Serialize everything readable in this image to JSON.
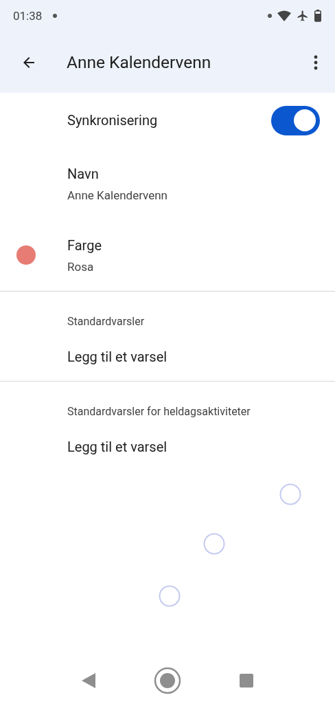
{
  "status_bar": {
    "time": "01:38"
  },
  "app_bar": {
    "title": "Anne Kalendervenn"
  },
  "settings": [
    {
      "kind": "toggle",
      "label": "Synkronisering",
      "on": true
    },
    {
      "kind": "detail",
      "label": "Navn",
      "value": "Anne Kalendervenn"
    },
    {
      "kind": "color",
      "label": "Farge",
      "value": "Rosa",
      "color": "#e67c73"
    }
  ],
  "sections": [
    {
      "header": "Standardvarsler",
      "action": "Legg til et varsel"
    },
    {
      "header": "Standardvarsler for heldagsaktiviteter",
      "action": "Legg til et varsel"
    }
  ]
}
